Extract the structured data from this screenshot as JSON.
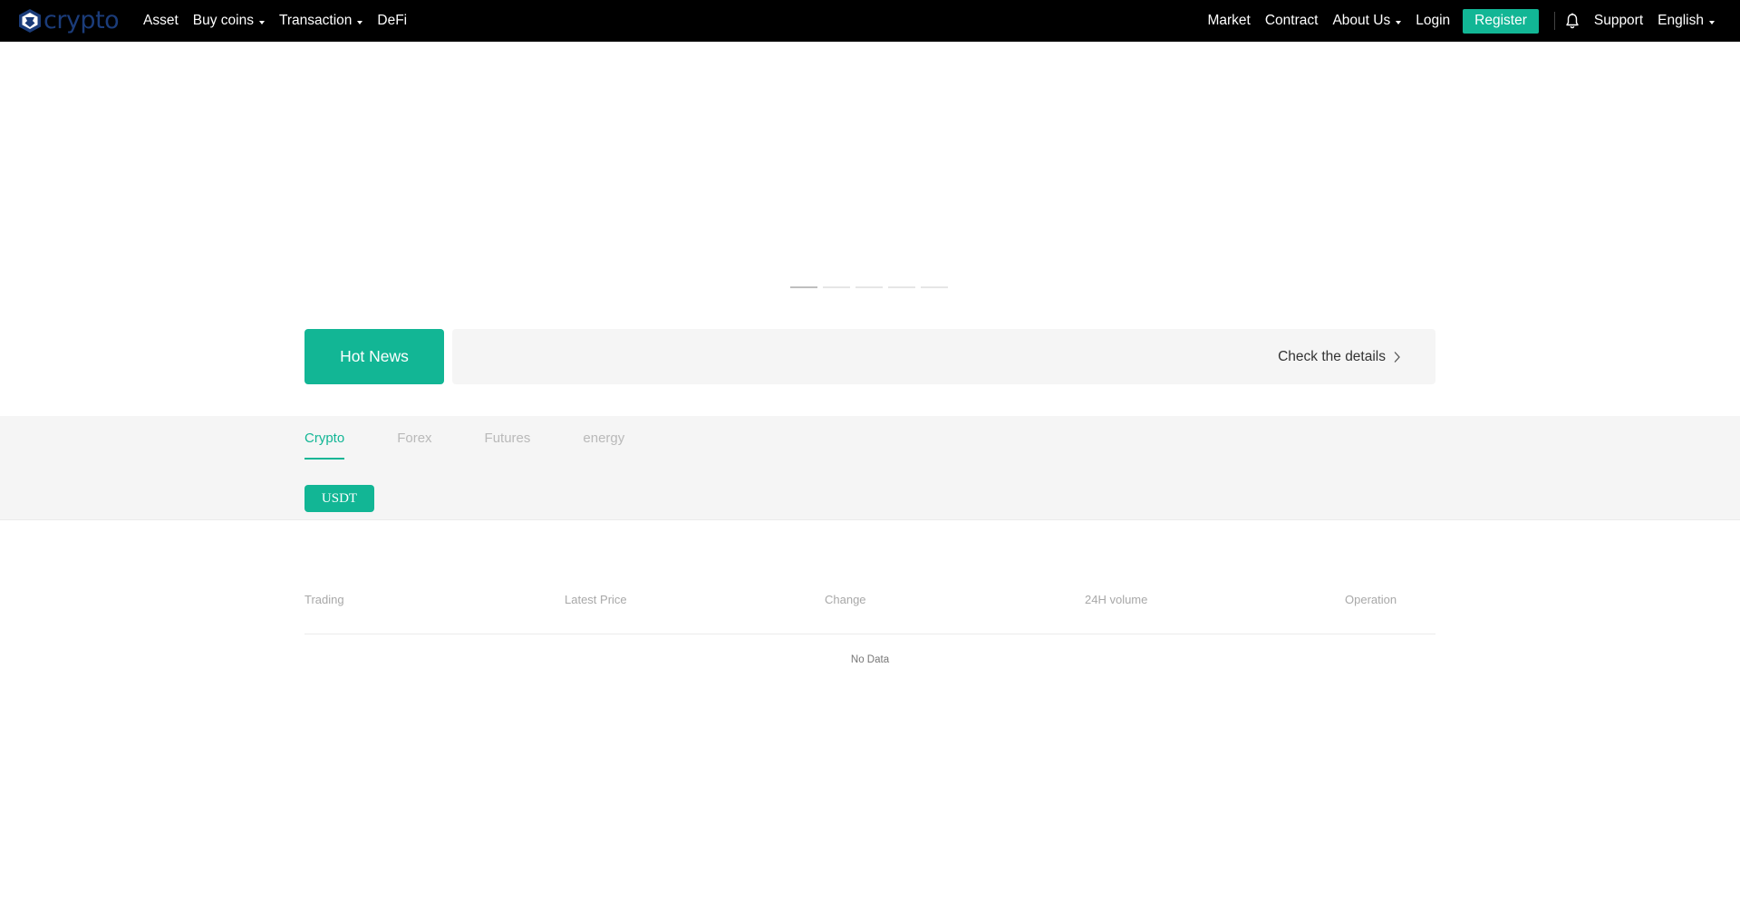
{
  "brand": {
    "name": "crypto"
  },
  "nav_left": [
    {
      "label": "Asset",
      "dropdown": false
    },
    {
      "label": "Buy coins",
      "dropdown": true
    },
    {
      "label": "Transaction",
      "dropdown": true
    },
    {
      "label": "DeFi",
      "dropdown": false
    }
  ],
  "nav_right": {
    "market": "Market",
    "contract": "Contract",
    "about": "About Us",
    "login": "Login",
    "register": "Register",
    "support": "Support",
    "language": "English"
  },
  "carousel": {
    "slides": 5,
    "active": 0
  },
  "hot_news": {
    "label": "Hot News",
    "details": "Check the details"
  },
  "market": {
    "tabs": [
      "Crypto",
      "Forex",
      "Futures",
      "energy"
    ],
    "active_tab": 0,
    "quote": "USDT"
  },
  "table": {
    "columns": [
      "Trading",
      "Latest Price",
      "Change",
      "24H volume",
      "Operation"
    ],
    "empty_text": "No Data"
  },
  "colors": {
    "accent": "#12b695",
    "navbar": "#000000",
    "brand_text": "#1b3c7a"
  }
}
